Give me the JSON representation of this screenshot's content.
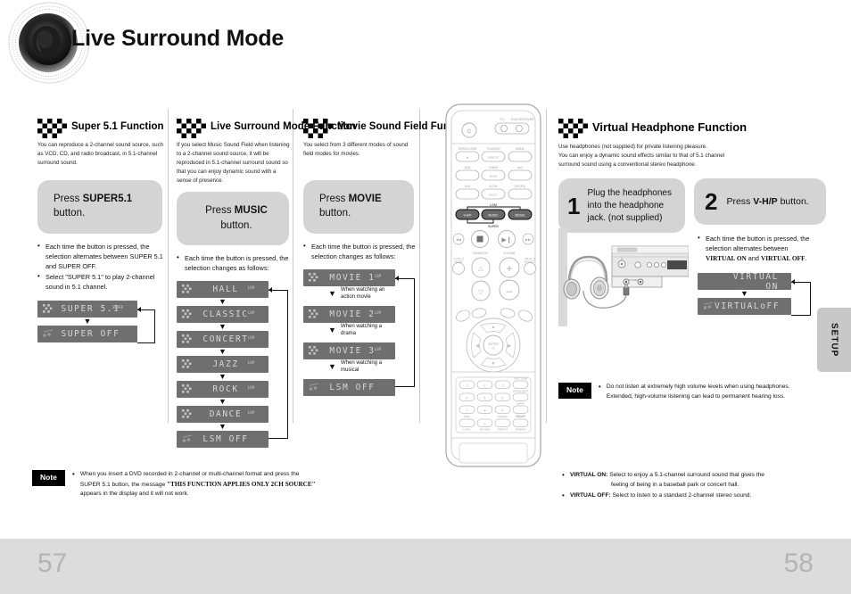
{
  "header": {
    "title": "Live Surround Mode",
    "logo_icon": "speaker-cone-icon"
  },
  "sections": {
    "super51": {
      "icon": "checker-arrow-icon",
      "title": "Super 5.1 Function",
      "intro": "You can reproduce a 2-channel sound source, such as VCD, CD, and radio broadcast, in 5.1-channel surround sound.",
      "press_prefix": "Press ",
      "press_bold": "SUPER5.1",
      "press_suffix": " button.",
      "bullets": [
        "Each time the button is pressed, the selection alternates between SUPER 5.1 and SUPER OFF.",
        "Select \"SUPER 5.1\" to play 2-channel sound in 5.1 channel."
      ],
      "displays": [
        {
          "text": "SUPER 5.1",
          "sup": "SUPER",
          "icon": "dolby-icon"
        },
        {
          "text": "SUPER OFF",
          "sup": "",
          "icon": "dolby-off-icon"
        }
      ]
    },
    "music": {
      "icon": "checker-arrow-icon",
      "title": "Live Surround Mode Function",
      "intro": "If you select Music Sound Field when listening to a 2-channel sound source, it will be reproduced in 5.1-channel surround sound so that you can enjoy dynamic sound with a sense of presence.",
      "press_prefix": "Press ",
      "press_bold": "MUSIC",
      "press_suffix": " button.",
      "bullets": [
        "Each time the button is pressed, the selection changes as follows:"
      ],
      "displays": [
        {
          "text": "HALL",
          "sup": "LSM",
          "icon": "dolby-icon"
        },
        {
          "text": "CLASSIC",
          "sup": "LSM",
          "icon": "dolby-icon"
        },
        {
          "text": "CONCERT",
          "sup": "LSM",
          "icon": "dolby-icon"
        },
        {
          "text": "JAZZ",
          "sup": "LSM",
          "icon": "dolby-icon"
        },
        {
          "text": "ROCK",
          "sup": "LSM",
          "icon": "dolby-icon"
        },
        {
          "text": "DANCE",
          "sup": "LSM",
          "icon": "dolby-icon"
        },
        {
          "text": "LSM OFF",
          "sup": "",
          "icon": "dolby-off-icon"
        }
      ]
    },
    "movie": {
      "icon": "checker-arrow-icon",
      "title": "Movie Sound Field Function",
      "intro": "You select from 3 different modes of sound field modes for movies.",
      "press_prefix": "Press ",
      "press_bold": "MOVIE",
      "press_suffix": " button.",
      "bullets": [
        "Each time the button is pressed, the selection changes as follows:"
      ],
      "displays": [
        {
          "text": "MOVIE 1",
          "sup": "LSM",
          "icon": "dolby-icon",
          "note": "When watching an action movie"
        },
        {
          "text": "MOVIE 2",
          "sup": "LSM",
          "icon": "dolby-icon",
          "note": "When watching a drama"
        },
        {
          "text": "MOVIE 3",
          "sup": "LSM",
          "icon": "dolby-icon",
          "note": "When watching a musical"
        },
        {
          "text": "LSM OFF",
          "sup": "",
          "icon": "dolby-off-icon",
          "note": ""
        }
      ]
    },
    "virtual": {
      "icon": "checker-arrow-icon",
      "title": "Virtual Headphone Function",
      "intro": "Use headphones (not supplied) for private listening pleasure.\nYou can enjoy a dynamic sound effects similar to that of 5.1 channel\nsurround sound using a conventional stereo headphone.",
      "steps": [
        {
          "number": "1",
          "text": "Plug the headphones into the headphone jack. (not supplied)"
        },
        {
          "number": "2",
          "prefix": "Press ",
          "bold": "V-H/P",
          "suffix": " button."
        }
      ],
      "bullet_line1": "Each time the button is pressed, the",
      "bullet_line2": "selection alternates between",
      "bullet_bold1": "VIRTUAL ON",
      "bullet_mid": " and ",
      "bullet_bold2": "VIRTUAL OFF",
      "bullet_end": ".",
      "displays": [
        {
          "text": "VIRTUAL ON",
          "icon": "headphone-icon"
        },
        {
          "text": "VIRTUALoFF",
          "icon": "headphone-off-icon"
        }
      ],
      "illustration": "headphone-connection-diagram"
    }
  },
  "notes": {
    "left": {
      "badge": "Note",
      "line1": "When you insert a DVD recorded in 2-channel or multi-channel format and press the",
      "line2_pre": "SUPER 5.1 button, the message ",
      "line2_bold": "\"THIS FUNCTION APPLIES ONLY 2CH SOURCE\"",
      "line3": "appears in the display and it will not work."
    },
    "right": {
      "badge": "Note",
      "line1": "Do not listen at extremely high volume levels when using headphones.",
      "line2": "Extended, high-volume listening can lead to permanent hearing loss."
    }
  },
  "virtual_modes": [
    {
      "label": "VIRTUAL ON:",
      "text": " Select to enjoy a 5.1-channel surround sound that gives the",
      "cont": "feeling of being in a baseball park or concert hall."
    },
    {
      "label": "VIRTUAL OFF:",
      "text": " Select to listen to a standard 2-channel stereo sound.",
      "cont": ""
    }
  ],
  "remote": {
    "name": "remote-control-illustration",
    "highlighted_buttons": [
      "V-H/P",
      "MUSIC",
      "MOVIE"
    ],
    "group_label_top": "LSM",
    "group_label_bottom": "SUPER"
  },
  "setup_tab": {
    "label": "SETUP"
  },
  "footer": {
    "page_left": "57",
    "page_right": "58"
  },
  "colors": {
    "press_box": "#d4d4d4",
    "vfd": "#6f6f6f",
    "vfd_text": "#d8d8d8",
    "footer": "#dcdcdc",
    "tab": "#c8c8c8"
  }
}
